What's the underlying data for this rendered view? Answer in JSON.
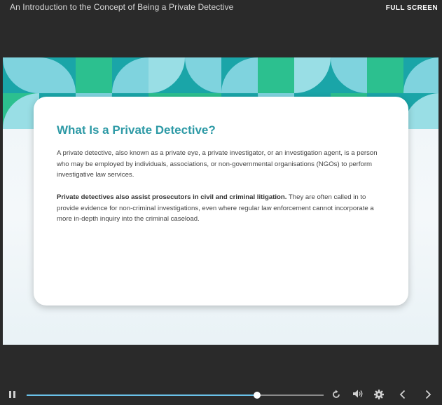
{
  "header": {
    "course_title": "An Introduction to the Concept of Being a Private Detective",
    "fullscreen_label": "FULL SCREEN"
  },
  "slide": {
    "heading": "What Is a Private Detective?",
    "paragraph1": "A private detective, also known as a private eye, a private investigator, or an investigation agent, is a person who may be employed by individuals, associations, or non-governmental organisations (NGOs) to perform investigative law services.",
    "paragraph2_bold": "Private detectives also assist prosecutors in civil and criminal litigation.",
    "paragraph2_rest": " They are often called in to provide evidence for non-criminal investigations, even where regular law enforcement cannot incorporate a more in-depth inquiry into the criminal caseload."
  },
  "player": {
    "progress_fraction": 0.775,
    "icons": [
      "pause-icon",
      "replay-icon",
      "volume-icon",
      "settings-icon",
      "previous-icon",
      "next-icon"
    ]
  },
  "colors": {
    "background": "#2a2a2a",
    "accent": "#2e9aa6",
    "progress": "#6ac1e8",
    "banner_teal": "#1aa5a8",
    "banner_green": "#2cc08f",
    "banner_light": "#7fd3de"
  }
}
